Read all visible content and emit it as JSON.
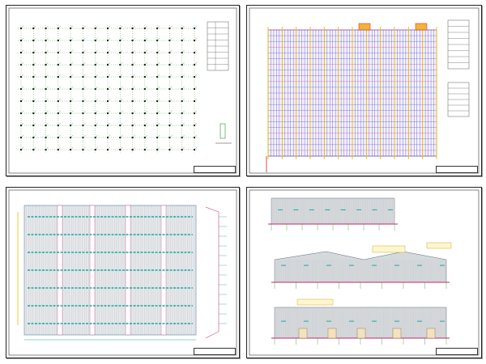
{
  "app": {
    "title": "",
    "background": "#ffffff"
  },
  "sheets": [
    {
      "name": "foundation-grid-plan",
      "title_block_text": "",
      "line_color": "#2e8b2e"
    },
    {
      "name": "roof-purlin-plan",
      "title_block_text": "",
      "line_colors": [
        "#2233cc",
        "#d63fb0",
        "#e6c200",
        "#cc2222"
      ]
    },
    {
      "name": "roof-panel-layout",
      "title_block_text": "",
      "line_colors": [
        "#1aa8a8",
        "#c94b8a",
        "#9aa0a6"
      ]
    },
    {
      "name": "building-elevations",
      "title_block_text": "",
      "notes": [
        "",
        "",
        "",
        ""
      ],
      "line_colors": [
        "#c0c4c8",
        "#c0286e",
        "#2e9b2e",
        "#3aa0d0"
      ]
    }
  ],
  "colors": {
    "frame": "#222222",
    "grid_green": "#2e8b2e",
    "purple": "#5a2ea6",
    "magenta": "#d63fb0",
    "yellow": "#e6c200",
    "cyan": "#1aa8a8",
    "annotation": "#c99a00"
  }
}
